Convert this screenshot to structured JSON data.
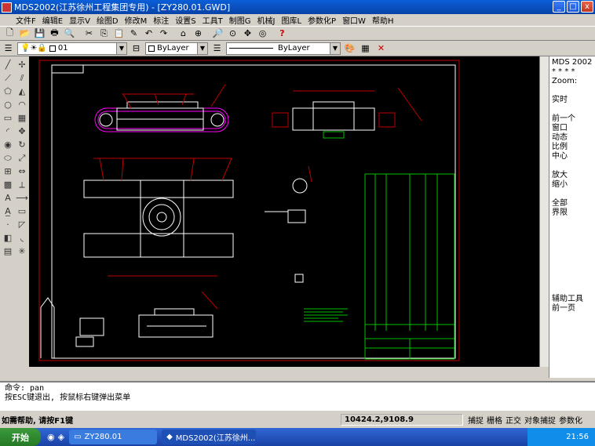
{
  "window": {
    "title": "MDS2002(江苏徐州工程集团专用) - [ZY280.01.GWD]",
    "minimize_glyph": "_",
    "maximize_glyph": "□",
    "close_glyph": "x"
  },
  "menu": [
    "文件F",
    "编辑E",
    "显示V",
    "绘图D",
    "修改M",
    "标注",
    "设置S",
    "工具T",
    "制图G",
    "机械J",
    "图库L",
    "参数化P",
    "窗口W",
    "帮助H"
  ],
  "toolbar2": {
    "layer_name": "01",
    "color_value": "ByLayer",
    "linetype_value": "ByLayer"
  },
  "side_menu": {
    "header": "MDS 2002",
    "stars": "* * * *",
    "zoom": "Zoom:",
    "items1": [
      "实时"
    ],
    "items2": [
      "前一个",
      "窗口",
      "动态",
      "比例",
      "中心"
    ],
    "items3": [
      "放大",
      "缩小"
    ],
    "items4": [
      "全部",
      "界限"
    ],
    "items5": [
      "辅助工具",
      "前一页"
    ]
  },
  "command": {
    "line1": "命令: pan",
    "line2": "按ESC键退出, 按鼠标右键弹出菜单"
  },
  "status": {
    "help": "如需帮助, 请按F1键",
    "coords": "10424.2,9108.9",
    "modes": [
      "捕捉",
      "栅格",
      "正交",
      "对象捕捉",
      "参数化"
    ]
  },
  "taskbar": {
    "start": "开始",
    "tasks": [
      "ZY280.01",
      "MDS2002(江苏徐州..."
    ],
    "clock": "21:56"
  },
  "colors": {
    "border_red": "#c00000",
    "drawing_white": "#ffffff",
    "drawing_magenta": "#ff00ff",
    "drawing_green": "#00c000"
  }
}
